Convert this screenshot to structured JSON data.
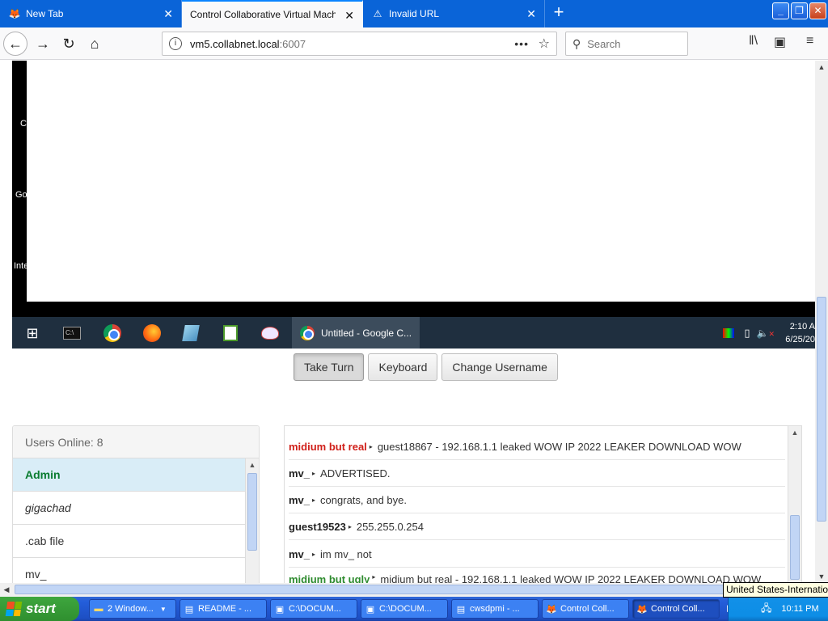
{
  "browser": {
    "tabs": [
      {
        "label": "New Tab",
        "icon": "firefox-icon"
      },
      {
        "label": "Control Collaborative Virtual Machines!",
        "icon": "none"
      },
      {
        "label": "Invalid URL",
        "icon": "warning-icon"
      }
    ],
    "url": {
      "host": "vm5.collabnet.local",
      "port": ":6007"
    },
    "search_placeholder": "Search"
  },
  "vm": {
    "side_labels": [
      "C",
      "Go",
      "Inte"
    ],
    "taskbar_active_window": "Untitled - Google C...",
    "clock_time": "2:10 A",
    "clock_date": "6/25/20"
  },
  "controls": {
    "take_turn": "Take Turn",
    "keyboard": "Keyboard",
    "change_username": "Change Username"
  },
  "users": {
    "header": "Users Online: 8",
    "list": [
      "Admin",
      "gigachad",
      ".cab file",
      "mv_"
    ]
  },
  "chat": {
    "messages": [
      {
        "user": "midium but real",
        "color": "red",
        "text": "guest18867 - 192.168.1.1 leaked WOW IP 2022 LEAKER DOWNLOAD WOW"
      },
      {
        "user": "mv_",
        "color": "black",
        "text": "ADVERTISED."
      },
      {
        "user": "mv_",
        "color": "black",
        "text": "congrats, and bye."
      },
      {
        "user": "guest19523",
        "color": "black",
        "text": "255.255.0.254"
      },
      {
        "user": "mv_",
        "color": "black",
        "text": "im mv_ not"
      },
      {
        "user": "midium but ugly",
        "color": "green",
        "text": "midium but real - 192.168.1.1 leaked WOW IP 2022 LEAKER DOWNLOAD WOW"
      }
    ]
  },
  "xp_taskbar": {
    "start_label": "start",
    "buttons": [
      "2 Window...",
      "README - ...",
      "C:\\DOCUM...",
      "C:\\DOCUM...",
      "cwsdpmi - ...",
      "Control Coll...",
      "Control Coll..."
    ],
    "tooltip": "United States-International",
    "clock": "10:11 PM"
  },
  "colors": {
    "accent": "#0a64d8",
    "user_red": "#d0201a",
    "user_green": "#2e8b2e",
    "admin_green": "#0a7c30"
  }
}
